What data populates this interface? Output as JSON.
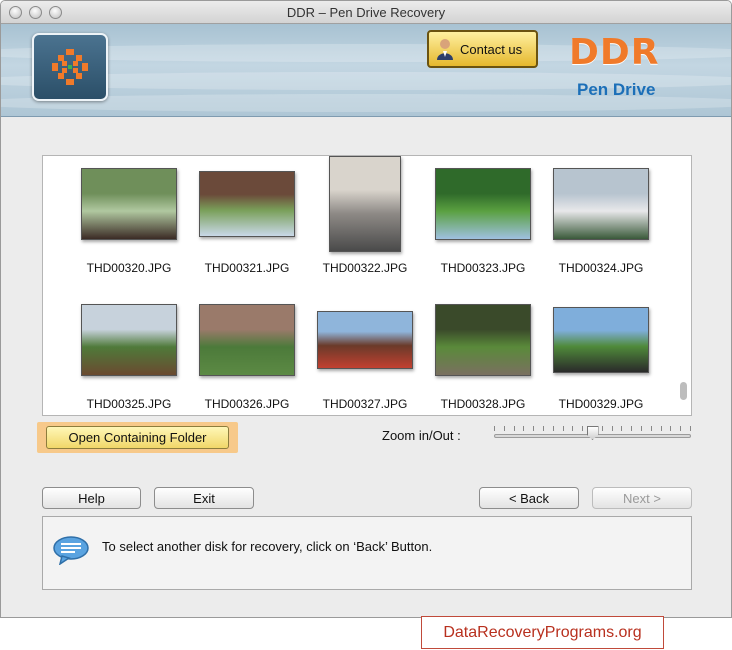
{
  "window": {
    "title": "DDR – Pen Drive Recovery"
  },
  "header": {
    "contact_label": "Contact us",
    "brand": "DDR",
    "brand_sub": "Pen Drive",
    "brand_color": "#f07a2a",
    "brand_sub_color": "#1c6fb8"
  },
  "gallery": {
    "items": [
      {
        "name": "THD00320.JPG",
        "colors": [
          "#6f8f5a",
          "#b0c8a0",
          "#3b2b25"
        ]
      },
      {
        "name": "THD00321.JPG",
        "colors": [
          "#6b4a3a",
          "#7aa05a",
          "#c9d8e8"
        ]
      },
      {
        "name": "THD00322.JPG",
        "colors": [
          "#d9d4cc",
          "#8e8a86",
          "#4a4a4a"
        ]
      },
      {
        "name": "THD00323.JPG",
        "colors": [
          "#2f6a2a",
          "#5aa040",
          "#9fc0e0"
        ]
      },
      {
        "name": "THD00324.JPG",
        "colors": [
          "#b7c4cf",
          "#e8e8ea",
          "#3a5a3a"
        ]
      },
      {
        "name": "THD00325.JPG",
        "colors": [
          "#c7d2dc",
          "#4f7a3a",
          "#6a4a30"
        ]
      },
      {
        "name": "THD00326.JPG",
        "colors": [
          "#9a7a6a",
          "#4c7a3a",
          "#5c8a44"
        ]
      },
      {
        "name": "THD00327.JPG",
        "colors": [
          "#8fb5db",
          "#6a3a2a",
          "#c24030"
        ]
      },
      {
        "name": "THD00328.JPG",
        "colors": [
          "#3a4a2a",
          "#5a8a3a",
          "#7a7060"
        ]
      },
      {
        "name": "THD00329.JPG",
        "colors": [
          "#7faedb",
          "#4f8a3a",
          "#2a2a2a"
        ]
      }
    ]
  },
  "actions": {
    "open_folder_label": "Open Containing Folder",
    "zoom_label": "Zoom in/Out :",
    "zoom_value": 0.5,
    "help_label": "Help",
    "exit_label": "Exit",
    "back_label": "< Back",
    "next_label": "Next >"
  },
  "status": {
    "icon": "speech-bubble-icon",
    "message": "To select another disk for recovery, click on ‘Back’ Button."
  },
  "footer": {
    "link_text": "DataRecoveryPrograms.org",
    "link_color": "#b8301e"
  }
}
